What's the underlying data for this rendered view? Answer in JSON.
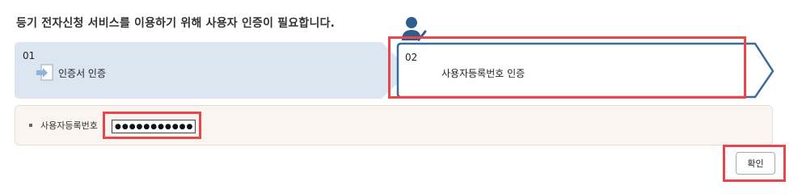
{
  "header": {
    "text": "등기 전자신청 서비스를 이용하기 위해 사용자 인증이 필요합니다."
  },
  "steps": [
    {
      "number": "01",
      "label": "인증서 인증",
      "icon": "arrow-into-document-icon",
      "active": false
    },
    {
      "number": "02",
      "label": "사용자등록번호 인증",
      "icon": "user-check-icon",
      "active": true
    }
  ],
  "form": {
    "label": "사용자등록번호",
    "password_value": "●●●●●●●●●●●●"
  },
  "actions": {
    "confirm_label": "확인"
  },
  "colors": {
    "step_inactive_bg": "#dbe6f1",
    "step_active_border": "#3b6a9c",
    "highlight": "#e8464a",
    "form_bg": "#fbf5f1"
  }
}
